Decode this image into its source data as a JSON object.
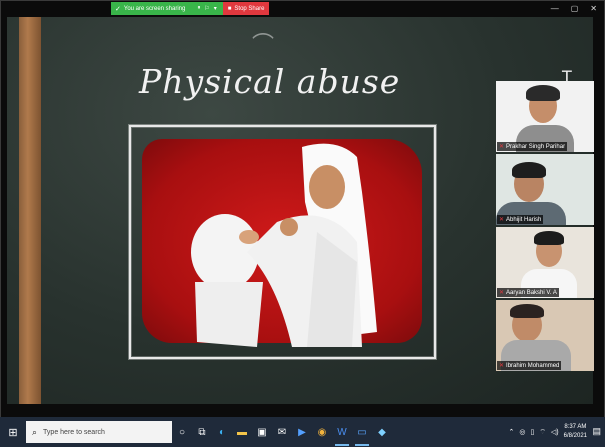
{
  "share_bar": {
    "status": "You are screen sharing",
    "stop_label": "Stop Share"
  },
  "window_controls": {
    "minimize": "—",
    "restore": "▢",
    "close": "✕"
  },
  "slide": {
    "title": "Physical abuse"
  },
  "participants": [
    {
      "name": "Prakhar Singh Parihar"
    },
    {
      "name": "Abhijit Harish"
    },
    {
      "name": "Aaryan Bakshi V. A"
    },
    {
      "name": "Ibrahim Mohammed"
    }
  ],
  "taskbar": {
    "search_placeholder": "Type here to search",
    "apps": [
      "task-view-icon",
      "edge-icon",
      "folder-icon",
      "store-icon",
      "mail-icon",
      "terminal-icon",
      "chrome-icon",
      "word-icon",
      "zoom-icon",
      "app-icon"
    ],
    "time": "8:37 AM",
    "date": "6/8/2021"
  },
  "colors": {
    "share_green": "#39b54a",
    "stop_red": "#e0383e",
    "taskbar": "#1f2a3a",
    "board": "#26302c"
  }
}
